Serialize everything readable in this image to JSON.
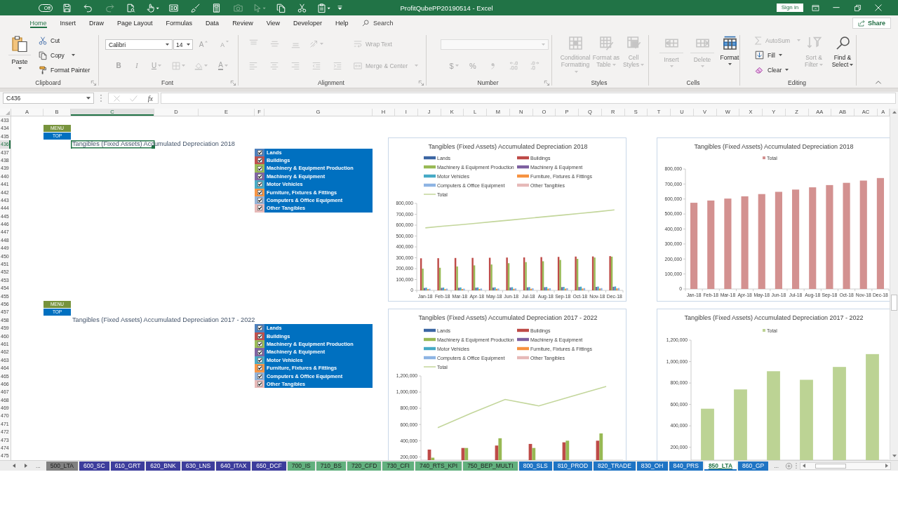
{
  "title_bar": {
    "autosave": "Off",
    "quick_access": [
      {
        "disabled": false,
        "dropdown": false
      },
      {
        "disabled": false,
        "dropdown": false
      },
      {
        "disabled": true,
        "dropdown": false
      },
      {
        "disabled": false,
        "dropdown": false
      },
      {
        "disabled": false,
        "dropdown": true
      },
      {
        "disabled": false,
        "dropdown": false
      },
      {
        "disabled": false,
        "dropdown": false
      },
      {
        "disabled": false,
        "dropdown": false
      },
      {
        "disabled": true,
        "dropdown": false
      },
      {
        "disabled": true,
        "dropdown": true
      },
      {
        "disabled": false,
        "dropdown": false
      },
      {
        "disabled": false,
        "dropdown": false
      },
      {
        "disabled": false,
        "dropdown": true
      }
    ],
    "title": "ProfitQubePP20190514 - Excel",
    "sign_in": "Sign in"
  },
  "ribbon_tabs": [
    {
      "label": "Home",
      "selected": true
    },
    {
      "label": "Insert",
      "selected": false
    },
    {
      "label": "Draw",
      "selected": false
    },
    {
      "label": "Page Layout",
      "selected": false
    },
    {
      "label": "Formulas",
      "selected": false
    },
    {
      "label": "Data",
      "selected": false
    },
    {
      "label": "Review",
      "selected": false
    },
    {
      "label": "View",
      "selected": false
    },
    {
      "label": "Developer",
      "selected": false
    },
    {
      "label": "Help",
      "selected": false
    }
  ],
  "tell_me": "Search",
  "share": "Share",
  "ribbon": {
    "clipboard": {
      "label": "Clipboard",
      "launcher": true,
      "paste": {
        "label": "Paste",
        "disabled": false
      },
      "cut": {
        "label": "Cut",
        "disabled": false
      },
      "copy": {
        "label": "Copy",
        "disabled": false
      },
      "format_painter": {
        "label": "Format Painter",
        "disabled": false
      }
    },
    "font": {
      "label": "Font",
      "launcher": true,
      "font_name": {
        "value": "Calibri",
        "disabled": false
      },
      "font_size": {
        "value": "14",
        "disabled": false
      },
      "grow_font": {
        "label": "A",
        "disabled": true
      },
      "shrink_font": {
        "label": "A",
        "disabled": true
      },
      "bold": {
        "label": "B",
        "disabled": true
      },
      "italic": {
        "label": "I",
        "disabled": true
      },
      "underline": {
        "label": "U",
        "disabled": true
      },
      "borders": {
        "disabled": true
      },
      "fill_color": {
        "disabled": true
      },
      "font_color": {
        "label": "A",
        "disabled": true
      }
    },
    "alignment": {
      "label": "Alignment",
      "launcher": true,
      "top_align": {
        "disabled": true
      },
      "middle_align": {
        "disabled": true
      },
      "bottom_align": {
        "disabled": true
      },
      "orientation": {
        "disabled": true
      },
      "wrap_text": {
        "label": "Wrap Text",
        "disabled": true
      },
      "align_left": {
        "disabled": true
      },
      "center": {
        "disabled": true
      },
      "align_right": {
        "disabled": true
      },
      "decrease_indent": {
        "disabled": true
      },
      "increase_indent": {
        "disabled": true
      },
      "merge_center": {
        "label": "Merge & Center",
        "disabled": true
      }
    },
    "number": {
      "label": "Number",
      "launcher": true,
      "number_format": {
        "disabled": true
      },
      "currency": {
        "label": "$",
        "disabled": true
      },
      "percent": {
        "label": "%",
        "disabled": true
      },
      "comma_style": {
        "disabled": true
      },
      "increase_decimal": {
        "disabled": true
      },
      "decrease_decimal": {
        "disabled": true
      }
    },
    "styles": {
      "label": "Styles",
      "conditional_formatting": {
        "label": "Conditional Formatting",
        "disabled": true
      },
      "format_as_table": {
        "label": "Format as Table",
        "disabled": true
      },
      "cell_styles": {
        "label": "Cell Styles",
        "disabled": true
      }
    },
    "cells": {
      "label": "Cells",
      "insert": {
        "label": "Insert",
        "disabled": true
      },
      "delete": {
        "label": "Delete",
        "disabled": true
      },
      "format": {
        "label": "Format",
        "disabled": false
      }
    },
    "editing": {
      "label": "Editing",
      "autosum": {
        "label": "AutoSum",
        "disabled": true
      },
      "fill": {
        "label": "Fill",
        "disabled": false
      },
      "clear": {
        "label": "Clear",
        "disabled": false
      },
      "sort_filter": {
        "label": "Sort & Filter",
        "disabled": true
      },
      "find_select": {
        "label": "Find & Select",
        "disabled": false
      }
    }
  },
  "formula_bar": {
    "name_box": "C436",
    "cancel": {
      "disabled": true
    },
    "enter": {
      "disabled": true
    },
    "function_label": "fx"
  },
  "sheet": {
    "columns": [
      {
        "label": "A",
        "selected": false
      },
      {
        "label": "B",
        "selected": false
      },
      {
        "label": "C",
        "selected": true
      },
      {
        "label": "D",
        "selected": false
      },
      {
        "label": "E",
        "selected": false
      },
      {
        "label": "F",
        "selected": false
      },
      {
        "label": "G",
        "selected": false
      },
      {
        "label": "H",
        "selected": false
      },
      {
        "label": "I",
        "selected": false
      },
      {
        "label": "J",
        "selected": false
      },
      {
        "label": "K",
        "selected": false
      },
      {
        "label": "L",
        "selected": false
      },
      {
        "label": "M",
        "selected": false
      },
      {
        "label": "N",
        "selected": false
      },
      {
        "label": "O",
        "selected": false
      },
      {
        "label": "P",
        "selected": false
      },
      {
        "label": "Q",
        "selected": false
      },
      {
        "label": "R",
        "selected": false
      },
      {
        "label": "S",
        "selected": false
      },
      {
        "label": "T",
        "selected": false
      },
      {
        "label": "U",
        "selected": false
      },
      {
        "label": "V",
        "selected": false
      },
      {
        "label": "W",
        "selected": false
      },
      {
        "label": "X",
        "selected": false
      },
      {
        "label": "Y",
        "selected": false
      },
      {
        "label": "Z",
        "selected": false
      },
      {
        "label": "AA",
        "selected": false
      },
      {
        "label": "AB",
        "selected": false
      },
      {
        "label": "AC",
        "selected": false
      },
      {
        "label": "A",
        "selected": false
      }
    ],
    "rows": [
      {
        "label": "433",
        "selected": false
      },
      {
        "label": "434",
        "selected": false
      },
      {
        "label": "435",
        "selected": false
      },
      {
        "label": "436",
        "selected": true
      },
      {
        "label": "437",
        "selected": false
      },
      {
        "label": "438",
        "selected": false
      },
      {
        "label": "439",
        "selected": false
      },
      {
        "label": "440",
        "selected": false
      },
      {
        "label": "441",
        "selected": false
      },
      {
        "label": "442",
        "selected": false
      },
      {
        "label": "443",
        "selected": false
      },
      {
        "label": "444",
        "selected": false
      },
      {
        "label": "445",
        "selected": false
      },
      {
        "label": "446",
        "selected": false
      },
      {
        "label": "447",
        "selected": false
      },
      {
        "label": "448",
        "selected": false
      },
      {
        "label": "449",
        "selected": false
      },
      {
        "label": "450",
        "selected": false
      },
      {
        "label": "451",
        "selected": false
      },
      {
        "label": "452",
        "selected": false
      },
      {
        "label": "453",
        "selected": false
      },
      {
        "label": "454",
        "selected": false
      },
      {
        "label": "455",
        "selected": false
      },
      {
        "label": "456",
        "selected": false
      },
      {
        "label": "457",
        "selected": false
      },
      {
        "label": "458",
        "selected": false
      },
      {
        "label": "459",
        "selected": false
      },
      {
        "label": "460",
        "selected": false
      },
      {
        "label": "461",
        "selected": false
      },
      {
        "label": "462",
        "selected": false
      },
      {
        "label": "463",
        "selected": false
      },
      {
        "label": "464",
        "selected": false
      },
      {
        "label": "465",
        "selected": false
      },
      {
        "label": "466",
        "selected": false
      },
      {
        "label": "467",
        "selected": false
      },
      {
        "label": "468",
        "selected": false
      },
      {
        "label": "469",
        "selected": false
      },
      {
        "label": "470",
        "selected": false
      },
      {
        "label": "471",
        "selected": false
      },
      {
        "label": "472",
        "selected": false
      },
      {
        "label": "473",
        "selected": false
      },
      {
        "label": "474",
        "selected": false
      },
      {
        "label": "475",
        "selected": false
      }
    ],
    "sections": [
      {
        "menu_button": "MENU",
        "top_button": "TOP",
        "title": "Tangibles (Fixed Assets) Accumulated Depreciation 2018",
        "title_selected": true,
        "filters": [
          {
            "label": "Lands",
            "color": "#4f81bd",
            "checked": true
          },
          {
            "label": "Buildings",
            "color": "#c0504d",
            "checked": true
          },
          {
            "label": "Machinery & Equipment Production",
            "color": "#9bbb59",
            "checked": true
          },
          {
            "label": "Machinery & Equipment",
            "color": "#8064a2",
            "checked": true
          },
          {
            "label": "Motor Vehicles",
            "color": "#4bacc6",
            "checked": true
          },
          {
            "label": "Furniture, Fixtures & Fittings",
            "color": "#f79646",
            "checked": true
          },
          {
            "label": "Computers & Office Equipment",
            "color": "#95b3d7",
            "checked": true
          },
          {
            "label": "Other Tangibles",
            "color": "#e6b9b8",
            "checked": true
          }
        ],
        "charts": [
          {
            "chart_data": {
              "type": "bar",
              "title": "Tangibles (Fixed Assets) Accumulated Depreciation 2018",
              "legend": "top",
              "categories": [
                "Jan-18",
                "Feb-18",
                "Mar-18",
                "Apr-18",
                "May-18",
                "Jun-18",
                "Jul-18",
                "Aug-18",
                "Sep-18",
                "Oct-18",
                "Nov-18",
                "Dec-18"
              ],
              "series": [
                {
                  "name": "Lands",
                  "type": "bar",
                  "color": "#3c66a3",
                  "values": [
                    0,
                    0,
                    0,
                    0,
                    0,
                    0,
                    0,
                    0,
                    0,
                    0,
                    0,
                    0
                  ]
                },
                {
                  "name": "Buildings",
                  "type": "bar",
                  "color": "#be4b48",
                  "values": [
                    295000,
                    296000,
                    298000,
                    299000,
                    300000,
                    302000,
                    303000,
                    306000,
                    308000,
                    311000,
                    312000,
                    315000
                  ]
                },
                {
                  "name": "Machinery & Equipment Production",
                  "type": "bar",
                  "color": "#98b954",
                  "values": [
                    200000,
                    208000,
                    220000,
                    230000,
                    238000,
                    250000,
                    260000,
                    268000,
                    280000,
                    290000,
                    302000,
                    310000
                  ]
                },
                {
                  "name": "Machinery & Equipment",
                  "type": "bar",
                  "color": "#7d60a0",
                  "values": [
                    22000,
                    23000,
                    24000,
                    25000,
                    26000,
                    27000,
                    28000,
                    29000,
                    30000,
                    31000,
                    32000,
                    33000
                  ]
                },
                {
                  "name": "Motor Vehicles",
                  "type": "bar",
                  "color": "#46aac5",
                  "values": [
                    25000,
                    26000,
                    27000,
                    27000,
                    28000,
                    29000,
                    30000,
                    31000,
                    32000,
                    34000,
                    35000,
                    36000
                  ]
                },
                {
                  "name": "Furniture, Fixtures & Fittings",
                  "type": "bar",
                  "color": "#f69240",
                  "values": [
                    12000,
                    12000,
                    13000,
                    13000,
                    14000,
                    14000,
                    15000,
                    16000,
                    16000,
                    17000,
                    17000,
                    18000
                  ]
                },
                {
                  "name": "Computers & Office Equipment",
                  "type": "bar",
                  "color": "#8eb4e3",
                  "values": [
                    15000,
                    16000,
                    16000,
                    17000,
                    17000,
                    18000,
                    19000,
                    20000,
                    20000,
                    21000,
                    21000,
                    22000
                  ]
                },
                {
                  "name": "Other Tangibles",
                  "type": "bar",
                  "color": "#e6b9b8",
                  "values": [
                    0,
                    0,
                    0,
                    0,
                    0,
                    0,
                    0,
                    0,
                    0,
                    0,
                    0,
                    0
                  ]
                },
                {
                  "name": "Total",
                  "type": "line",
                  "color": "#c3d69b",
                  "values": [
                    575000,
                    590000,
                    603000,
                    618000,
                    633000,
                    648000,
                    663000,
                    678000,
                    693000,
                    708000,
                    723000,
                    740000
                  ]
                }
              ],
              "ylim": [
                0,
                800000
              ],
              "yticks": [
                {
                  "value": 0,
                  "label": "0"
                },
                {
                  "value": 100000,
                  "label": "100,000"
                },
                {
                  "value": 200000,
                  "label": "200,000"
                },
                {
                  "value": 300000,
                  "label": "300,000"
                },
                {
                  "value": 400000,
                  "label": "400,000"
                },
                {
                  "value": 500000,
                  "label": "500,000"
                },
                {
                  "value": 600000,
                  "label": "600,000"
                },
                {
                  "value": 700000,
                  "label": "700,000"
                },
                {
                  "value": 800000,
                  "label": "800,000"
                }
              ]
            }
          },
          {
            "chart_data": {
              "type": "bar",
              "title": "Tangibles (Fixed Assets) Accumulated Depreciation 2018",
              "legend": "top",
              "categories": [
                "Jan-18",
                "Feb-18",
                "Mar-18",
                "Apr-18",
                "May-18",
                "Jun-18",
                "Jul-18",
                "Aug-18",
                "Sep-18",
                "Oct-18",
                "Nov-18",
                "Dec-18"
              ],
              "series": [
                {
                  "name": "Total",
                  "type": "bar",
                  "color": "#d39190",
                  "values": [
                    575000,
                    590000,
                    603000,
                    618000,
                    633000,
                    648000,
                    663000,
                    678000,
                    693000,
                    708000,
                    723000,
                    740000
                  ]
                }
              ],
              "ylim": [
                0,
                800000
              ],
              "yticks": [
                {
                  "value": 0,
                  "label": "0"
                },
                {
                  "value": 100000,
                  "label": "100,000"
                },
                {
                  "value": 200000,
                  "label": "200,000"
                },
                {
                  "value": 300000,
                  "label": "300,000"
                },
                {
                  "value": 400000,
                  "label": "400,000"
                },
                {
                  "value": 500000,
                  "label": "500,000"
                },
                {
                  "value": 600000,
                  "label": "600,000"
                },
                {
                  "value": 700000,
                  "label": "700,000"
                },
                {
                  "value": 800000,
                  "label": "800,000"
                }
              ]
            }
          }
        ]
      },
      {
        "menu_button": "MENU",
        "top_button": "TOP",
        "title": "Tangibles (Fixed Assets) Accumulated Depreciation 2017 - 2022",
        "title_selected": false,
        "filters": [
          {
            "label": "Lands",
            "color": "#4f81bd",
            "checked": true
          },
          {
            "label": "Buildings",
            "color": "#c0504d",
            "checked": true
          },
          {
            "label": "Machinery & Equipment Production",
            "color": "#9bbb59",
            "checked": true
          },
          {
            "label": "Machinery & Equipment",
            "color": "#8064a2",
            "checked": true
          },
          {
            "label": "Motor Vehicles",
            "color": "#4bacc6",
            "checked": true
          },
          {
            "label": "Furniture, Fixtures & Fittings",
            "color": "#f79646",
            "checked": true
          },
          {
            "label": "Computers & Office Equipment",
            "color": "#95b3d7",
            "checked": true
          },
          {
            "label": "Other Tangibles",
            "color": "#e6b9b8",
            "checked": true
          }
        ],
        "charts": [
          {
            "chart_data": {
              "type": "bar",
              "title": "Tangibles (Fixed Assets) Accumulated Depreciation 2017 - 2022",
              "legend": "top",
              "categories": [
                null,
                null,
                null,
                null,
                null,
                null
              ],
              "series": [
                {
                  "name": "Lands",
                  "type": "bar",
                  "color": "#3c66a3",
                  "values": [
                    null,
                    null,
                    null,
                    null,
                    null,
                    null
                  ]
                },
                {
                  "name": "Buildings",
                  "type": "bar",
                  "color": "#be4b48",
                  "values": [
                    290000,
                    310000,
                    340000,
                    360000,
                    380000,
                    400000
                  ]
                },
                {
                  "name": "Machinery & Equipment Production",
                  "type": "bar",
                  "color": "#98b954",
                  "values": [
                    190000,
                    310000,
                    430000,
                    310000,
                    400000,
                    490000
                  ]
                },
                {
                  "name": "Machinery & Equipment",
                  "type": "bar",
                  "color": "#7d60a0",
                  "values": [
                    null,
                    null,
                    null,
                    null,
                    null,
                    null
                  ]
                },
                {
                  "name": "Motor Vehicles",
                  "type": "bar",
                  "color": "#46aac5",
                  "values": [
                    null,
                    null,
                    null,
                    null,
                    null,
                    null
                  ]
                },
                {
                  "name": "Furniture, Fixtures & Fittings",
                  "type": "bar",
                  "color": "#f69240",
                  "values": [
                    null,
                    null,
                    null,
                    null,
                    null,
                    null
                  ]
                },
                {
                  "name": "Computers & Office Equipment",
                  "type": "bar",
                  "color": "#8eb4e3",
                  "values": [
                    null,
                    null,
                    null,
                    null,
                    null,
                    null
                  ]
                },
                {
                  "name": "Other Tangibles",
                  "type": "bar",
                  "color": "#e6b9b8",
                  "values": [
                    null,
                    null,
                    null,
                    null,
                    null,
                    null
                  ]
                },
                {
                  "name": "Total",
                  "type": "line",
                  "color": "#c3d69b",
                  "values": [
                    560000,
                    740000,
                    910000,
                    830000,
                    950000,
                    1070000
                  ]
                }
              ],
              "ylim": [
                160000,
                1200000
              ],
              "yticks": [
                {
                  "value": 200000,
                  "label": "200,000"
                },
                {
                  "value": 400000,
                  "label": "400,000"
                },
                {
                  "value": 600000,
                  "label": "600,000"
                },
                {
                  "value": 800000,
                  "label": "800,000"
                },
                {
                  "value": 1000000,
                  "label": "1,000,000"
                },
                {
                  "value": 1200000,
                  "label": "1,200,000"
                }
              ]
            }
          },
          {
            "chart_data": {
              "type": "bar",
              "title": "Tangibles (Fixed Assets) Accumulated Depreciation 2017 - 2022",
              "legend": "top",
              "categories": [
                null,
                null,
                null,
                null,
                null,
                null
              ],
              "series": [
                {
                  "name": "Total",
                  "type": "bar",
                  "color": "#bcd394",
                  "values": [
                    560000,
                    740000,
                    910000,
                    830000,
                    950000,
                    1070000
                  ]
                }
              ],
              "ylim": [
                80000,
                1200000
              ],
              "yticks": [
                {
                  "value": 200000,
                  "label": "200,000"
                },
                {
                  "value": 400000,
                  "label": "400,000"
                },
                {
                  "value": 600000,
                  "label": "600,000"
                },
                {
                  "value": 800000,
                  "label": "800,000"
                },
                {
                  "value": 1000000,
                  "label": "1,000,000"
                },
                {
                  "value": 1200000,
                  "label": "1,200,000"
                }
              ]
            }
          }
        ]
      }
    ]
  },
  "sheet_tabs": {
    "more_left": "...",
    "tabs": [
      {
        "label": "500_LTA",
        "color": "#808080",
        "selected": false
      },
      {
        "label": "600_SC",
        "color": "#3d3d9c",
        "selected": false
      },
      {
        "label": "610_GRT",
        "color": "#3d3d9c",
        "selected": false
      },
      {
        "label": "620_BNK",
        "color": "#3d3d9c",
        "selected": false
      },
      {
        "label": "630_LNS",
        "color": "#3d3d9c",
        "selected": false
      },
      {
        "label": "640_ITAX",
        "color": "#3d3d9c",
        "selected": false
      },
      {
        "label": "650_DCF",
        "color": "#3d3d9c",
        "selected": false
      },
      {
        "label": "700_IS",
        "color": "#62b07e",
        "selected": false
      },
      {
        "label": "710_BS",
        "color": "#62b07e",
        "selected": false
      },
      {
        "label": "720_CFD",
        "color": "#62b07e",
        "selected": false
      },
      {
        "label": "730_CFI",
        "color": "#62b07e",
        "selected": false
      },
      {
        "label": "740_RTS_KPI",
        "color": "#62b07e",
        "selected": false
      },
      {
        "label": "750_BEP_MULTI",
        "color": "#62b07e",
        "selected": false
      },
      {
        "label": "800_SLS",
        "color": "#1f74c4",
        "selected": false
      },
      {
        "label": "810_PROD",
        "color": "#1f74c4",
        "selected": false
      },
      {
        "label": "820_TRADE",
        "color": "#1f74c4",
        "selected": false
      },
      {
        "label": "830_OH",
        "color": "#1f74c4",
        "selected": false
      },
      {
        "label": "840_PRS",
        "color": "#1f74c4",
        "selected": false
      },
      {
        "label": "850_LTA",
        "color": "#1f74c4",
        "selected": true
      },
      {
        "label": "860_GP",
        "color": "#1f74c4",
        "selected": false
      }
    ],
    "more_right": "..."
  }
}
